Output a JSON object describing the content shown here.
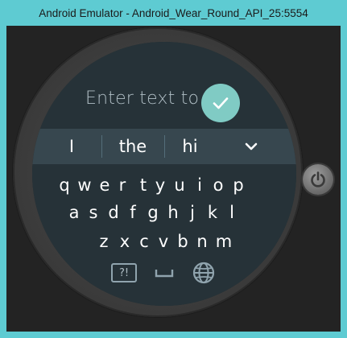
{
  "window": {
    "title": "Android Emulator - Android_Wear_Round_API_25:5554"
  },
  "entry": {
    "text": "Enter text to"
  },
  "suggestions": [
    "I",
    "the",
    "hi"
  ],
  "keyboard": {
    "row1": [
      "q",
      "w",
      "e",
      "r",
      "t",
      "y",
      "u",
      "i",
      "o",
      "p"
    ],
    "row2": [
      "a",
      "s",
      "d",
      "f",
      "g",
      "h",
      "j",
      "k",
      "l"
    ],
    "row3": [
      "z",
      "x",
      "c",
      "v",
      "b",
      "n",
      "m"
    ],
    "symbols_label": "?!"
  },
  "colors": {
    "accent": "#80cbc4",
    "screen_bg": "#263238",
    "suggestion_bar": "#37474f",
    "window_frame": "#5ecbd2"
  },
  "icons": {
    "confirm": "checkmark-icon",
    "expand": "chevron-down-icon",
    "space": "space-icon",
    "language": "globe-icon",
    "power": "power-icon"
  }
}
